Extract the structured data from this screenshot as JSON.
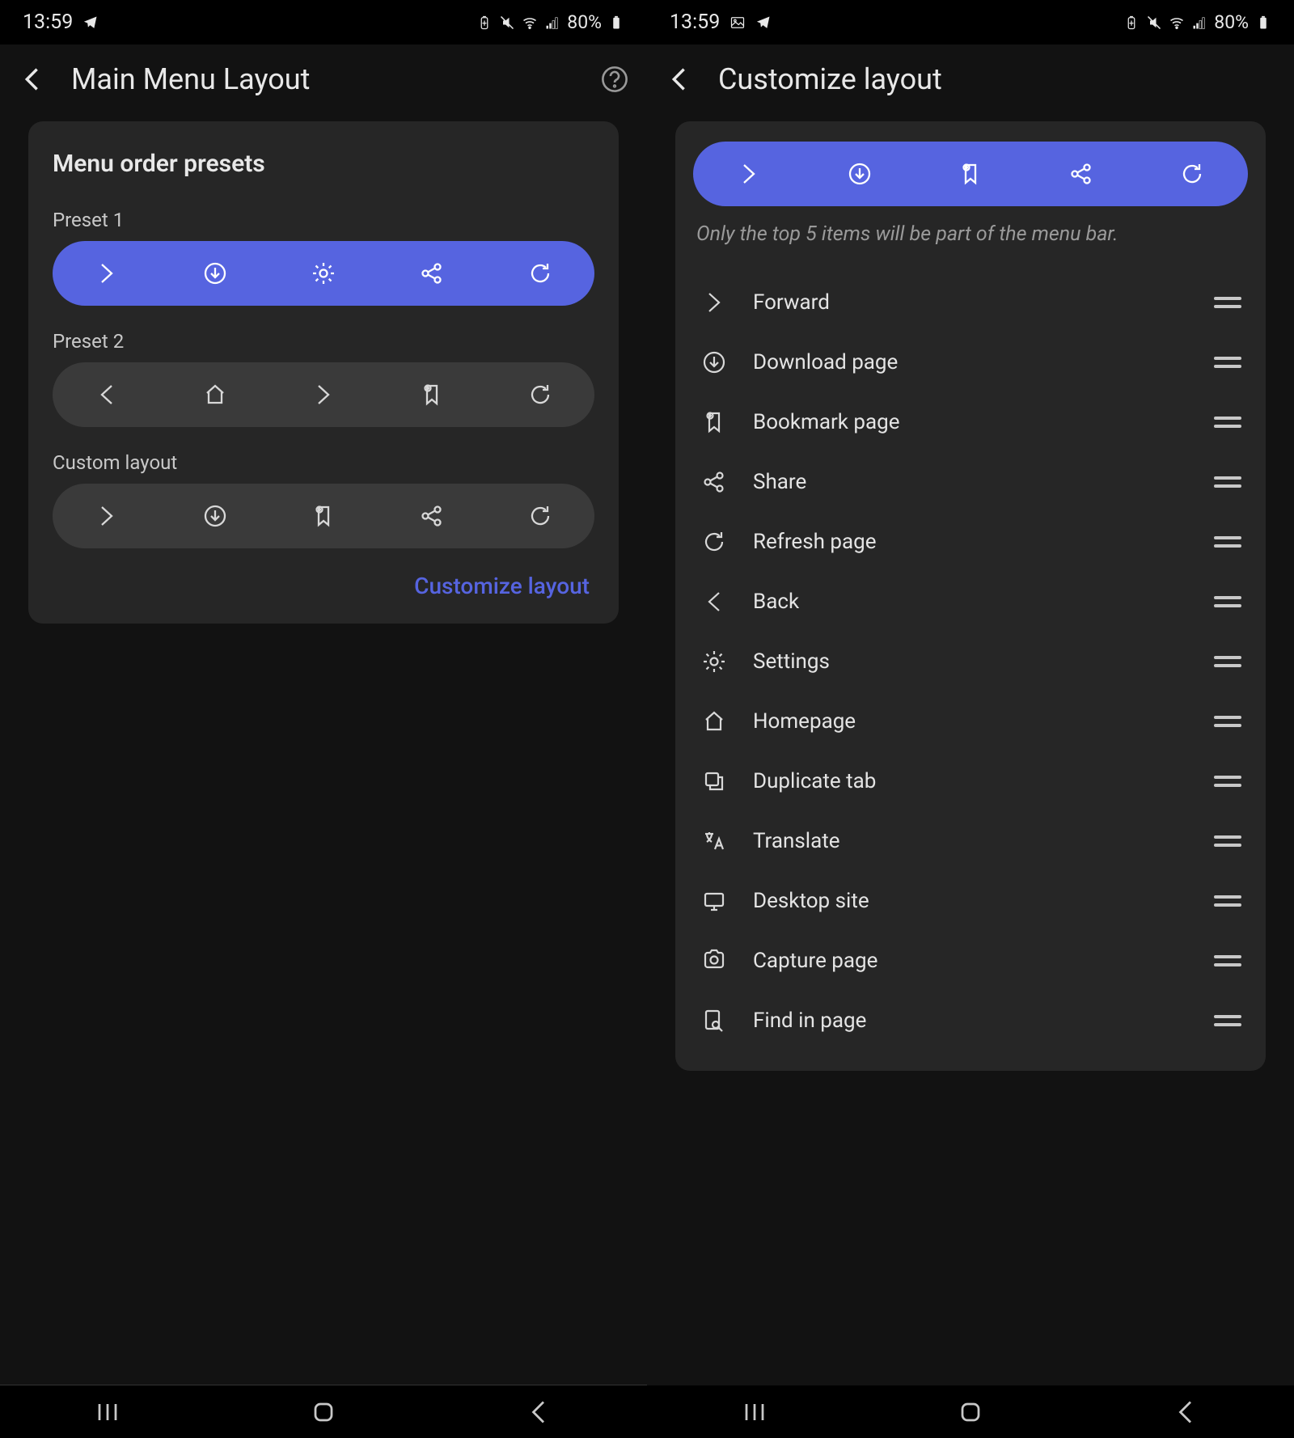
{
  "status": {
    "time": "13:59",
    "battery_pct": "80%"
  },
  "left": {
    "title": "Main Menu Layout",
    "card_title": "Menu order presets",
    "preset1_label": "Preset 1",
    "preset2_label": "Preset 2",
    "custom_label": "Custom layout",
    "customize_link": "Customize layout",
    "preset1_icons": [
      "forward",
      "download",
      "settings",
      "share",
      "refresh"
    ],
    "preset2_icons": [
      "back",
      "home",
      "forward",
      "bookmark",
      "refresh"
    ],
    "custom_icons": [
      "forward",
      "download",
      "bookmark",
      "share",
      "refresh"
    ]
  },
  "right": {
    "title": "Customize layout",
    "hint": "Only the top 5 items will be part of the menu bar.",
    "top_icons": [
      "forward",
      "download",
      "bookmark",
      "share",
      "refresh"
    ],
    "items": [
      {
        "icon": "forward",
        "label": "Forward"
      },
      {
        "icon": "download",
        "label": "Download page"
      },
      {
        "icon": "bookmark",
        "label": "Bookmark page"
      },
      {
        "icon": "share",
        "label": "Share"
      },
      {
        "icon": "refresh",
        "label": "Refresh page"
      },
      {
        "icon": "back",
        "label": "Back"
      },
      {
        "icon": "settings",
        "label": "Settings"
      },
      {
        "icon": "home",
        "label": "Homepage"
      },
      {
        "icon": "duplicate",
        "label": "Duplicate tab"
      },
      {
        "icon": "translate",
        "label": "Translate"
      },
      {
        "icon": "desktop",
        "label": "Desktop site"
      },
      {
        "icon": "capture",
        "label": "Capture page"
      },
      {
        "icon": "find",
        "label": "Find in page"
      }
    ]
  }
}
